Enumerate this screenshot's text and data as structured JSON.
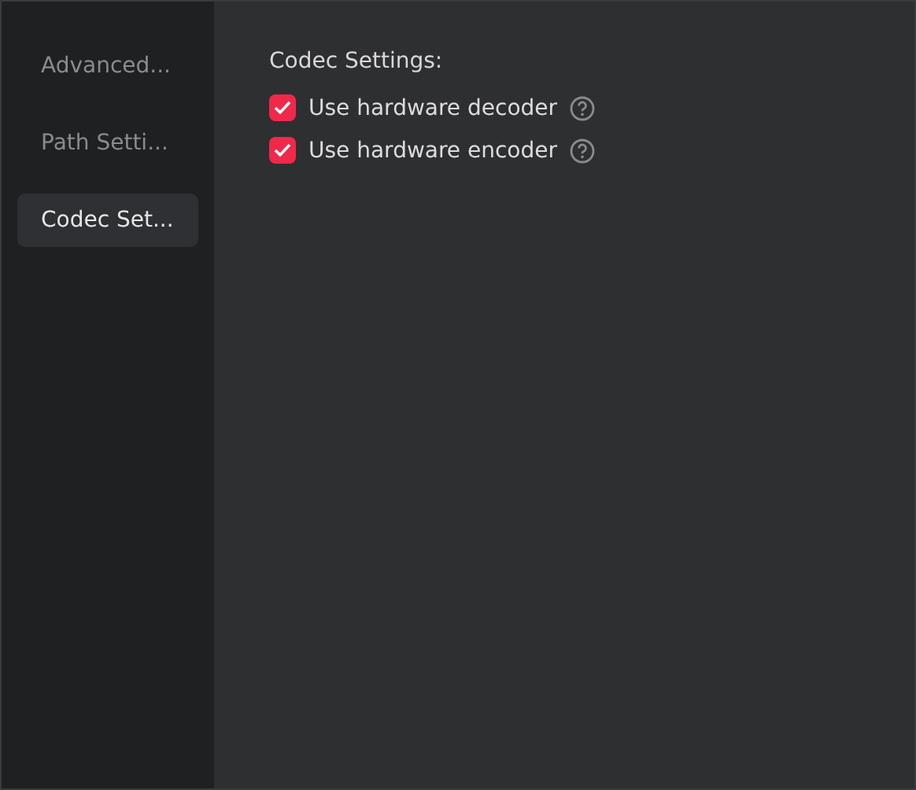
{
  "sidebar": {
    "items": [
      {
        "label": "Advanced...",
        "selected": false
      },
      {
        "label": "Path Setti...",
        "selected": false
      },
      {
        "label": "Codec Set...",
        "selected": true
      }
    ]
  },
  "section": {
    "title": "Codec Settings:",
    "options": [
      {
        "label": "Use hardware decoder",
        "checked": true
      },
      {
        "label": "Use hardware encoder",
        "checked": true
      }
    ]
  }
}
